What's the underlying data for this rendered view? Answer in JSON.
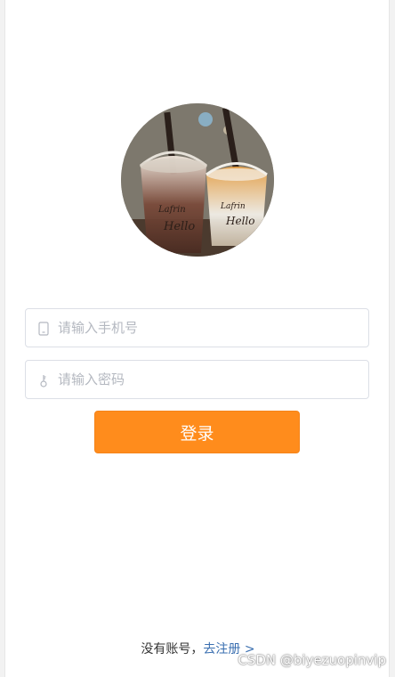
{
  "avatar": {
    "alt": "奶茶头像"
  },
  "login_form": {
    "phone": {
      "placeholder": "请输入手机号",
      "value": ""
    },
    "password": {
      "placeholder": "请输入密码",
      "value": ""
    },
    "submit_label": "登录"
  },
  "register": {
    "prompt": "没有账号，",
    "link_label": "去注册 >"
  },
  "watermark": "CSDN @biyezuopinvip",
  "colors": {
    "accent": "#ff8c1c",
    "link": "#3a6fb0",
    "border": "#dcdfe6",
    "placeholder": "#b4b8c0"
  },
  "icons": {
    "phone_field": "mobile-phone-icon",
    "password_field": "key-icon"
  }
}
